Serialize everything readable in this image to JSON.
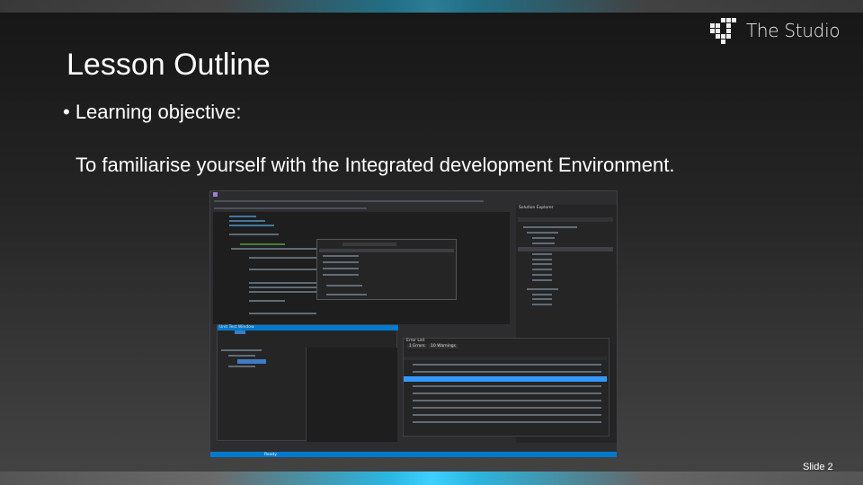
{
  "logo": {
    "text": "The Studio"
  },
  "slide": {
    "title": "Lesson Outline",
    "bullet": "• Learning objective:",
    "objective": "To familiarise yourself with the Integrated development Environment.",
    "number": "Slide 2"
  },
  "ide": {
    "solution_explorer": "Solution Explorer",
    "unit_test_window": "Unit Test Window",
    "error_list": "Error List",
    "errors_tab": "1 Errors",
    "warnings_tab": "10 Warnings",
    "status": "Ready"
  },
  "colors": {
    "accent": "#007acc",
    "background": "#2d2d30",
    "editor": "#1e1e1e"
  }
}
